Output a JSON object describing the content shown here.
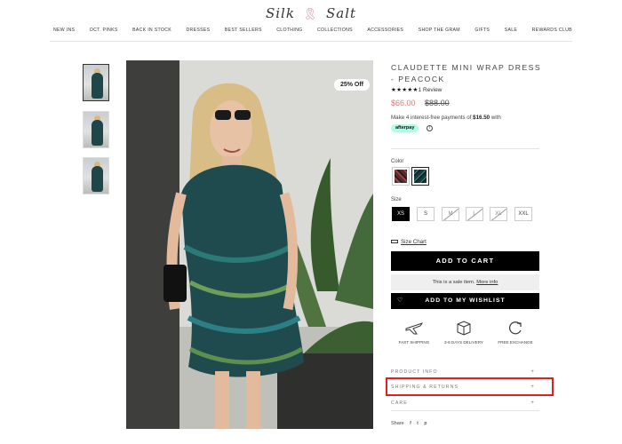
{
  "header": {
    "logo_left": "Silk",
    "logo_mark": "🎗",
    "logo_right": "Salt",
    "nav": [
      "NEW INS",
      "OCT. PINKS",
      "BACK IN STOCK",
      "DRESSES",
      "BEST SELLERS",
      "CLOTHING",
      "COLLECTIONS",
      "ACCESSORIES",
      "SHOP THE GRAM",
      "GIFTS",
      "SALE",
      "REWARDS CLUB"
    ]
  },
  "gallery": {
    "badge": "25% Off"
  },
  "product": {
    "title": "CLAUDETTE MINI WRAP DRESS - PEACOCK",
    "stars": "★★★★★",
    "reviews": "1 Review",
    "sale_price": "$66.00",
    "original_price": "$88.00",
    "afterpay_prefix": "Make 4 interest-free payments of ",
    "afterpay_amount": "$16.50",
    "afterpay_suffix": " with",
    "afterpay_logo": "afterpay",
    "afterpay_info": "i",
    "color_label": "Color",
    "size_label": "Size",
    "sizes": [
      "XS",
      "S",
      "M",
      "L",
      "XL",
      "XXL"
    ],
    "size_chart": "Size Chart",
    "add_to_cart": "ADD TO CART",
    "sale_note": "This is a sale item.",
    "sale_note_link": "More info",
    "wishlist": "ADD TO MY WISHLIST",
    "wishlist_icon": "♡"
  },
  "features": [
    {
      "label": "FAST SHIPPING",
      "icon": "airplane-icon"
    },
    {
      "label": "3-6 DAYS DELIVERY",
      "icon": "box-icon"
    },
    {
      "label": "FREE EXCHANGE",
      "icon": "refresh-icon"
    }
  ],
  "accordion": [
    "PRODUCT INFO",
    "SHIPPING & RETURNS",
    "CARE"
  ],
  "accordion_toggle": "+",
  "share": {
    "label": "Share",
    "icons": [
      "f",
      "t",
      "p"
    ]
  },
  "colors": {
    "accent_black": "#000000",
    "sale_red": "#e07a7a",
    "afterpay_mint": "#b2fce4",
    "highlight_red": "#e02020"
  }
}
